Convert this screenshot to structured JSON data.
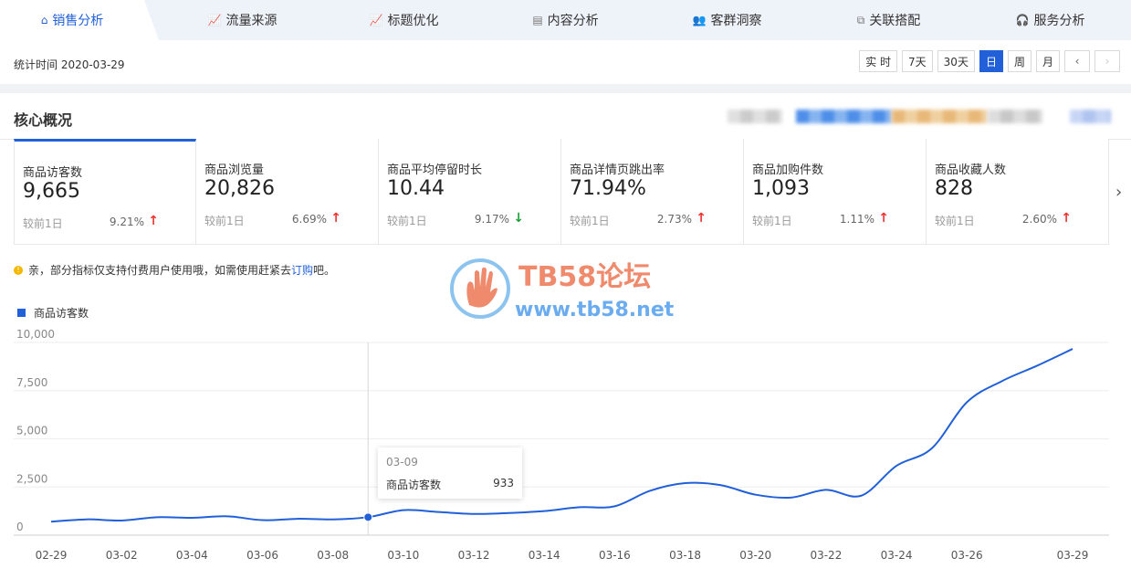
{
  "tabs": [
    {
      "label": "销售分析",
      "icon": "bag-icon",
      "glyph": "⌂",
      "active": true
    },
    {
      "label": "流量来源",
      "icon": "trend-line-icon",
      "glyph": "📈"
    },
    {
      "label": "标题优化",
      "icon": "trend-line-icon",
      "glyph": "📈"
    },
    {
      "label": "内容分析",
      "icon": "document-icon",
      "glyph": "▤"
    },
    {
      "label": "客群洞察",
      "icon": "users-icon",
      "glyph": "👥"
    },
    {
      "label": "关联搭配",
      "icon": "link-icon",
      "glyph": "⧉"
    },
    {
      "label": "服务分析",
      "icon": "headset-icon",
      "glyph": "🎧"
    }
  ],
  "date_bar": {
    "stat_time": "统计时间 2020-03-29",
    "buttons": [
      "实 时",
      "7天",
      "30天",
      "日",
      "周",
      "月"
    ],
    "active_button": "日",
    "prev": "‹",
    "next": "›"
  },
  "overview": {
    "title": "核心概况"
  },
  "cards": [
    {
      "label": "商品访客数",
      "value": "9,665",
      "compare": "较前1日",
      "pct": "9.21%",
      "trend": "up"
    },
    {
      "label": "商品浏览量",
      "value": "20,826",
      "compare": "较前1日",
      "pct": "6.69%",
      "trend": "up"
    },
    {
      "label": "商品平均停留时长",
      "value": "10.44",
      "compare": "较前1日",
      "pct": "9.17%",
      "trend": "down"
    },
    {
      "label": "商品详情页跳出率",
      "value": "71.94%",
      "compare": "较前1日",
      "pct": "2.73%",
      "trend": "up"
    },
    {
      "label": "商品加购件数",
      "value": "1,093",
      "compare": "较前1日",
      "pct": "1.11%",
      "trend": "up"
    },
    {
      "label": "商品收藏人数",
      "value": "828",
      "compare": "较前1日",
      "pct": "2.60%",
      "trend": "up"
    }
  ],
  "notice": {
    "text_before": "亲，部分指标仅支持付费用户使用哦，如需使用赶紧去 ",
    "link": "订购",
    "text_after": "吧。"
  },
  "watermark": {
    "title": "TB58论坛",
    "url": "www.tb58.net"
  },
  "tooltip": {
    "date": "03-09",
    "name": "商品访客数",
    "value": "933"
  },
  "colors": {
    "accent": "#2160d8",
    "up": "#e8352e",
    "down": "#1aa13a"
  },
  "chart_data": {
    "type": "line",
    "ylim": [
      0,
      10000
    ],
    "yticks": [
      "0",
      "2,500",
      "5,000",
      "7,500",
      "10,000"
    ],
    "x_tick_labels": [
      "02-29",
      "03-02",
      "03-04",
      "03-06",
      "03-08",
      "03-10",
      "03-12",
      "03-14",
      "03-16",
      "03-18",
      "03-20",
      "03-22",
      "03-24",
      "03-26",
      "03-29"
    ],
    "x": [
      "02-29",
      "03-01",
      "03-02",
      "03-03",
      "03-04",
      "03-05",
      "03-06",
      "03-07",
      "03-08",
      "03-09",
      "03-10",
      "03-11",
      "03-12",
      "03-13",
      "03-14",
      "03-15",
      "03-16",
      "03-17",
      "03-18",
      "03-19",
      "03-20",
      "03-21",
      "03-22",
      "03-23",
      "03-24",
      "03-25",
      "03-26",
      "03-27",
      "03-28",
      "03-29"
    ],
    "series": [
      {
        "name": "商品访客数",
        "values": [
          700,
          820,
          760,
          930,
          900,
          980,
          780,
          850,
          820,
          933,
          1300,
          1200,
          1100,
          1150,
          1250,
          1450,
          1500,
          2300,
          2700,
          2600,
          2100,
          1950,
          2350,
          2050,
          3600,
          4500,
          6900,
          8000,
          8800,
          9665
        ]
      }
    ],
    "highlight_index": 9
  }
}
